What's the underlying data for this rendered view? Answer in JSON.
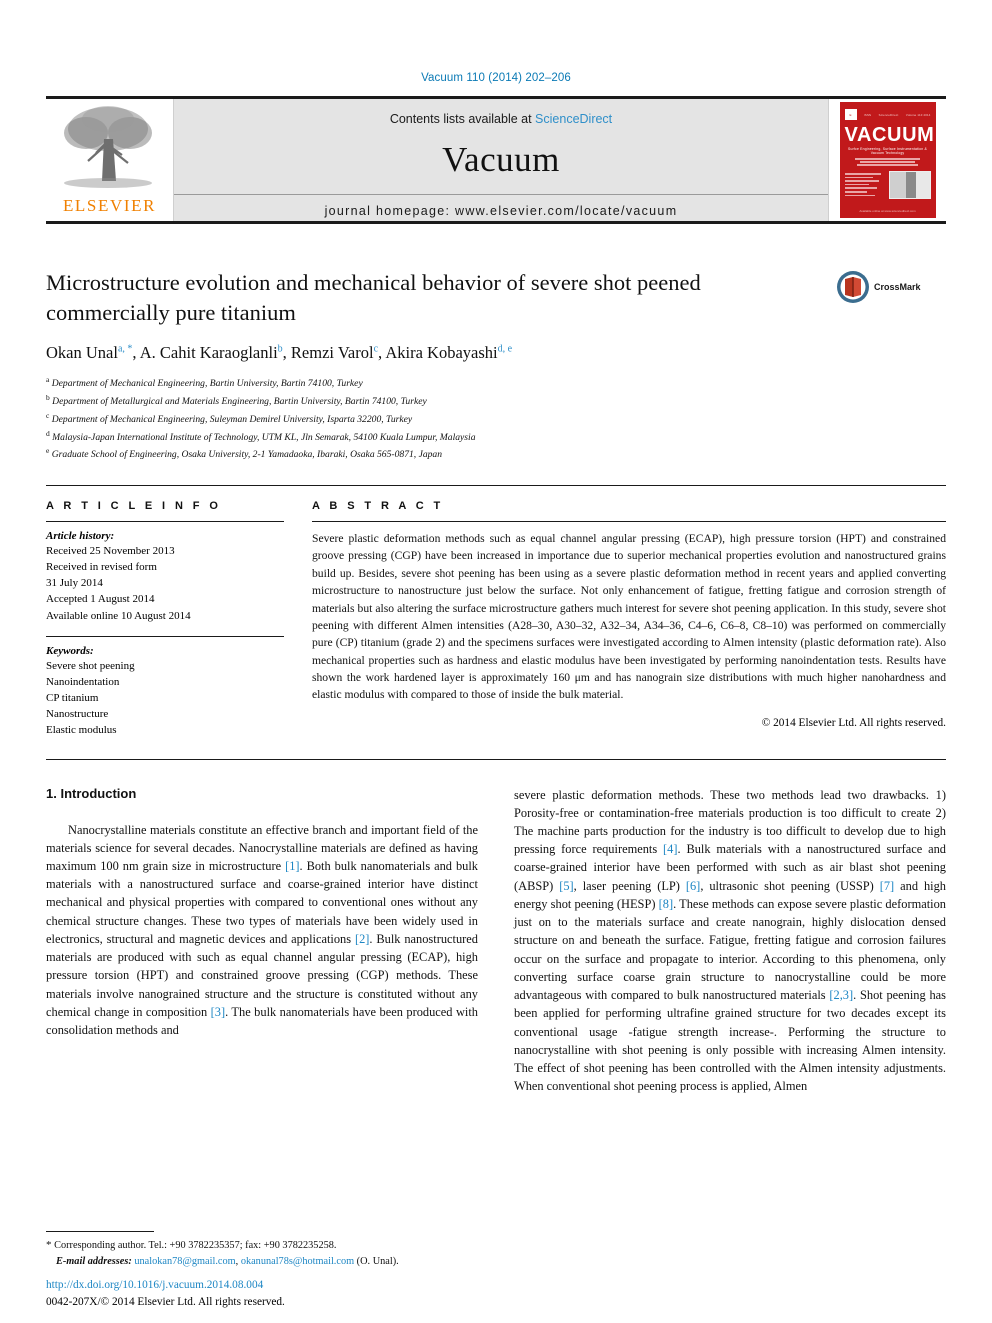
{
  "running_head": "Vacuum 110 (2014) 202–206",
  "masthead": {
    "publisher_name": "ELSEVIER",
    "contents_prefix": "Contents lists available at ",
    "contents_link": "ScienceDirect",
    "journal_name": "Vacuum",
    "homepage": "journal homepage: www.elsevier.com/locate/vacuum",
    "cover": {
      "title": "VACUUM",
      "subtitle": "Surfce Engineering, Surface Instrumentation & Vacuum Technology",
      "top_left": "ISSN",
      "top_mid": "ScienceDirect",
      "top_right": "Volume 110  2014",
      "footer": "Available online at www.sciencedirect.com"
    }
  },
  "article": {
    "title": "Microstructure evolution and mechanical behavior of severe shot peened commercially pure titanium",
    "authors": [
      {
        "name": "Okan Unal",
        "marks": "a, *"
      },
      {
        "name": "A. Cahit Karaoglanli",
        "marks": "b"
      },
      {
        "name": "Remzi Varol",
        "marks": "c"
      },
      {
        "name": "Akira Kobayashi",
        "marks": "d, e"
      }
    ],
    "affiliations": [
      {
        "mark": "a",
        "text": "Department of Mechanical Engineering, Bartin University, Bartin 74100, Turkey"
      },
      {
        "mark": "b",
        "text": "Department of Metallurgical and Materials Engineering, Bartin University, Bartin 74100, Turkey"
      },
      {
        "mark": "c",
        "text": "Department of Mechanical Engineering, Suleyman Demirel University, Isparta 32200, Turkey"
      },
      {
        "mark": "d",
        "text": "Malaysia-Japan International Institute of Technology, UTM KL, Jln Semarak, 54100 Kuala Lumpur, Malaysia"
      },
      {
        "mark": "e",
        "text": "Graduate School of Engineering, Osaka University, 2-1 Yamadaoka, Ibaraki, Osaka 565-0871, Japan"
      }
    ],
    "crossmark_label": "CrossMark"
  },
  "article_info": {
    "heading": "A R T I C L E   I N F O",
    "history_label": "Article history:",
    "history": [
      "Received 25 November 2013",
      "Received in revised form",
      "31 July 2014",
      "Accepted 1 August 2014",
      "Available online 10 August 2014"
    ],
    "keywords_label": "Keywords:",
    "keywords": [
      "Severe shot peening",
      "Nanoindentation",
      "CP titanium",
      "Nanostructure",
      "Elastic modulus"
    ]
  },
  "abstract": {
    "heading": "A B S T R A C T",
    "text": "Severe plastic deformation methods such as equal channel angular pressing (ECAP), high pressure torsion (HPT) and constrained groove pressing (CGP) have been increased in importance due to superior mechanical properties evolution and nanostructured grains build up. Besides, severe shot peening has been using as a severe plastic deformation method in recent years and applied converting microstructure to nanostructure just below the surface. Not only enhancement of fatigue, fretting fatigue and corrosion strength of materials but also altering the surface microstructure gathers much interest for severe shot peening application. In this study, severe shot peening with different Almen intensities (A28–30, A30–32, A32–34, A34–36, C4–6, C6–8, C8–10) was performed on commercially pure (CP) titanium (grade 2) and the specimens surfaces were investigated according to Almen intensity (plastic deformation rate). Also mechanical properties such as hardness and elastic modulus have been investigated by performing nanoindentation tests. Results have shown the work hardened layer is approximately 160 μm and has nanograin size distributions with much higher nanohardness and elastic modulus with compared to those of inside the bulk material.",
    "copyright": "© 2014 Elsevier Ltd. All rights reserved."
  },
  "body": {
    "section_heading": "1. Introduction",
    "left_paragraph_1": "Nanocrystalline materials constitute an effective branch and important field of the materials science for several decades. Nanocrystalline materials are defined as having maximum 100 nm grain size in microstructure ",
    "left_ref_1": "[1]",
    "left_paragraph_1b": ". Both bulk nanomaterials and bulk materials with a nanostructured surface and coarse-grained interior have distinct mechanical and physical properties with compared to conventional ones without any chemical structure changes. These two types of materials have been widely used in electronics, structural and magnetic devices and applications ",
    "left_ref_2": "[2]",
    "left_paragraph_1c": ". Bulk nanostructured materials are produced with such as equal channel angular pressing (ECAP), high pressure torsion (HPT) and constrained groove pressing (CGP) methods. These materials involve nanograined structure and the structure is constituted without any chemical change in composition ",
    "left_ref_3": "[3]",
    "left_paragraph_1d": ". The bulk nanomaterials have been produced with consolidation methods and",
    "right_paragraph_1a": "severe plastic deformation methods. These two methods lead two drawbacks. 1) Porosity-free or contamination-free materials production is too difficult to create 2) The machine parts production for the industry is too difficult to develop due to high pressing force requirements ",
    "right_ref_4": "[4]",
    "right_paragraph_1b": ". Bulk materials with a nanostructured surface and coarse-grained interior have been performed with such as air blast shot peening (ABSP) ",
    "right_ref_5": "[5]",
    "right_paragraph_1c": ", laser peening (LP) ",
    "right_ref_6": "[6]",
    "right_paragraph_1d": ", ultrasonic shot peening (USSP) ",
    "right_ref_7": "[7]",
    "right_paragraph_1e": " and high energy shot peening (HESP) ",
    "right_ref_8": "[8]",
    "right_paragraph_1f": ". These methods can expose severe plastic deformation just on to the materials surface and create nanograin, highly dislocation densed structure on and beneath the surface. Fatigue, fretting fatigue and corrosion failures occur on the surface and propagate to interior. According to this phenomena, only converting surface coarse grain structure to nanocrystalline could be more advantageous with compared to bulk nanostructured materials ",
    "right_ref_23": "[2,3]",
    "right_paragraph_1g": ". Shot peening has been applied for performing ultrafine grained structure for two decades except its conventional usage -fatigue strength increase-. Performing the structure to nanocrystalline with shot peening is only possible with increasing Almen intensity. The effect of shot peening has been controlled with the Almen intensity adjustments. When conventional shot peening process is applied, Almen"
  },
  "footer": {
    "corresponding_star": "*",
    "corresponding_text": " Corresponding author. Tel.: +90 3782235357; fax: +90 3782235258.",
    "email_label": "E-mail addresses:",
    "email_1": "unalokan78@gmail.com",
    "email_sep": ", ",
    "email_2": "okanunal78s@hotmail.com",
    "email_suffix": " (O. Unal).",
    "doi": "http://dx.doi.org/10.1016/j.vacuum.2014.08.004",
    "issn_line": "0042-207X/© 2014 Elsevier Ltd. All rights reserved."
  },
  "colors": {
    "link": "#1d86c4",
    "elsevier_orange": "#f08000",
    "cover_red": "#c1191b"
  }
}
